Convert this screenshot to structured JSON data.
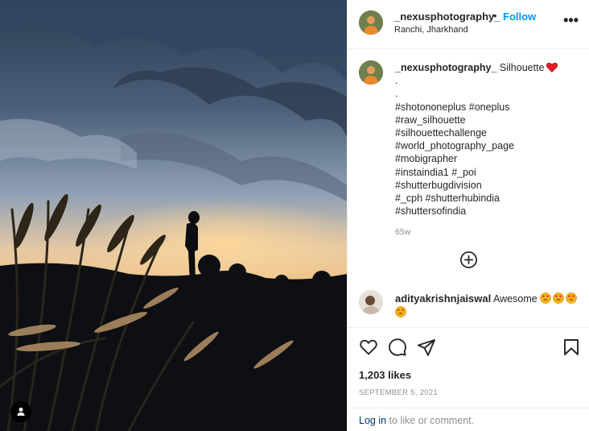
{
  "post": {
    "author": "_nexusphotography_",
    "follow_separator": "•",
    "follow_label": "Follow",
    "location": "Ranchi, Jharkhand",
    "more_icon": "more-options-icon",
    "more_glyph": "•••"
  },
  "caption": {
    "author": "_nexusphotography_",
    "text": "Silhouette",
    "lines": [
      ".",
      ".",
      "#shotononeplus #oneplus",
      "#raw_silhouette",
      "#silhouettechallenge",
      "#world_photography_page",
      "#mobigrapher",
      "#instaindia1 #_poi",
      "#shutterbugdivision",
      "#_cph #shutterhubindia",
      "#shuttersofindia"
    ],
    "time_ago": "65w"
  },
  "comment": {
    "author": "adityakrishnjaiswal",
    "text": "Awesome"
  },
  "engagement": {
    "likes": "1,203 likes",
    "date": "SEPTEMBER 5, 2021"
  },
  "login": {
    "link": "Log in",
    "rest": " to like or comment."
  },
  "colors": {
    "link_blue": "#0095f6",
    "text": "#262626",
    "muted": "#8e8e8e",
    "heart_red": "#ed1c24"
  }
}
